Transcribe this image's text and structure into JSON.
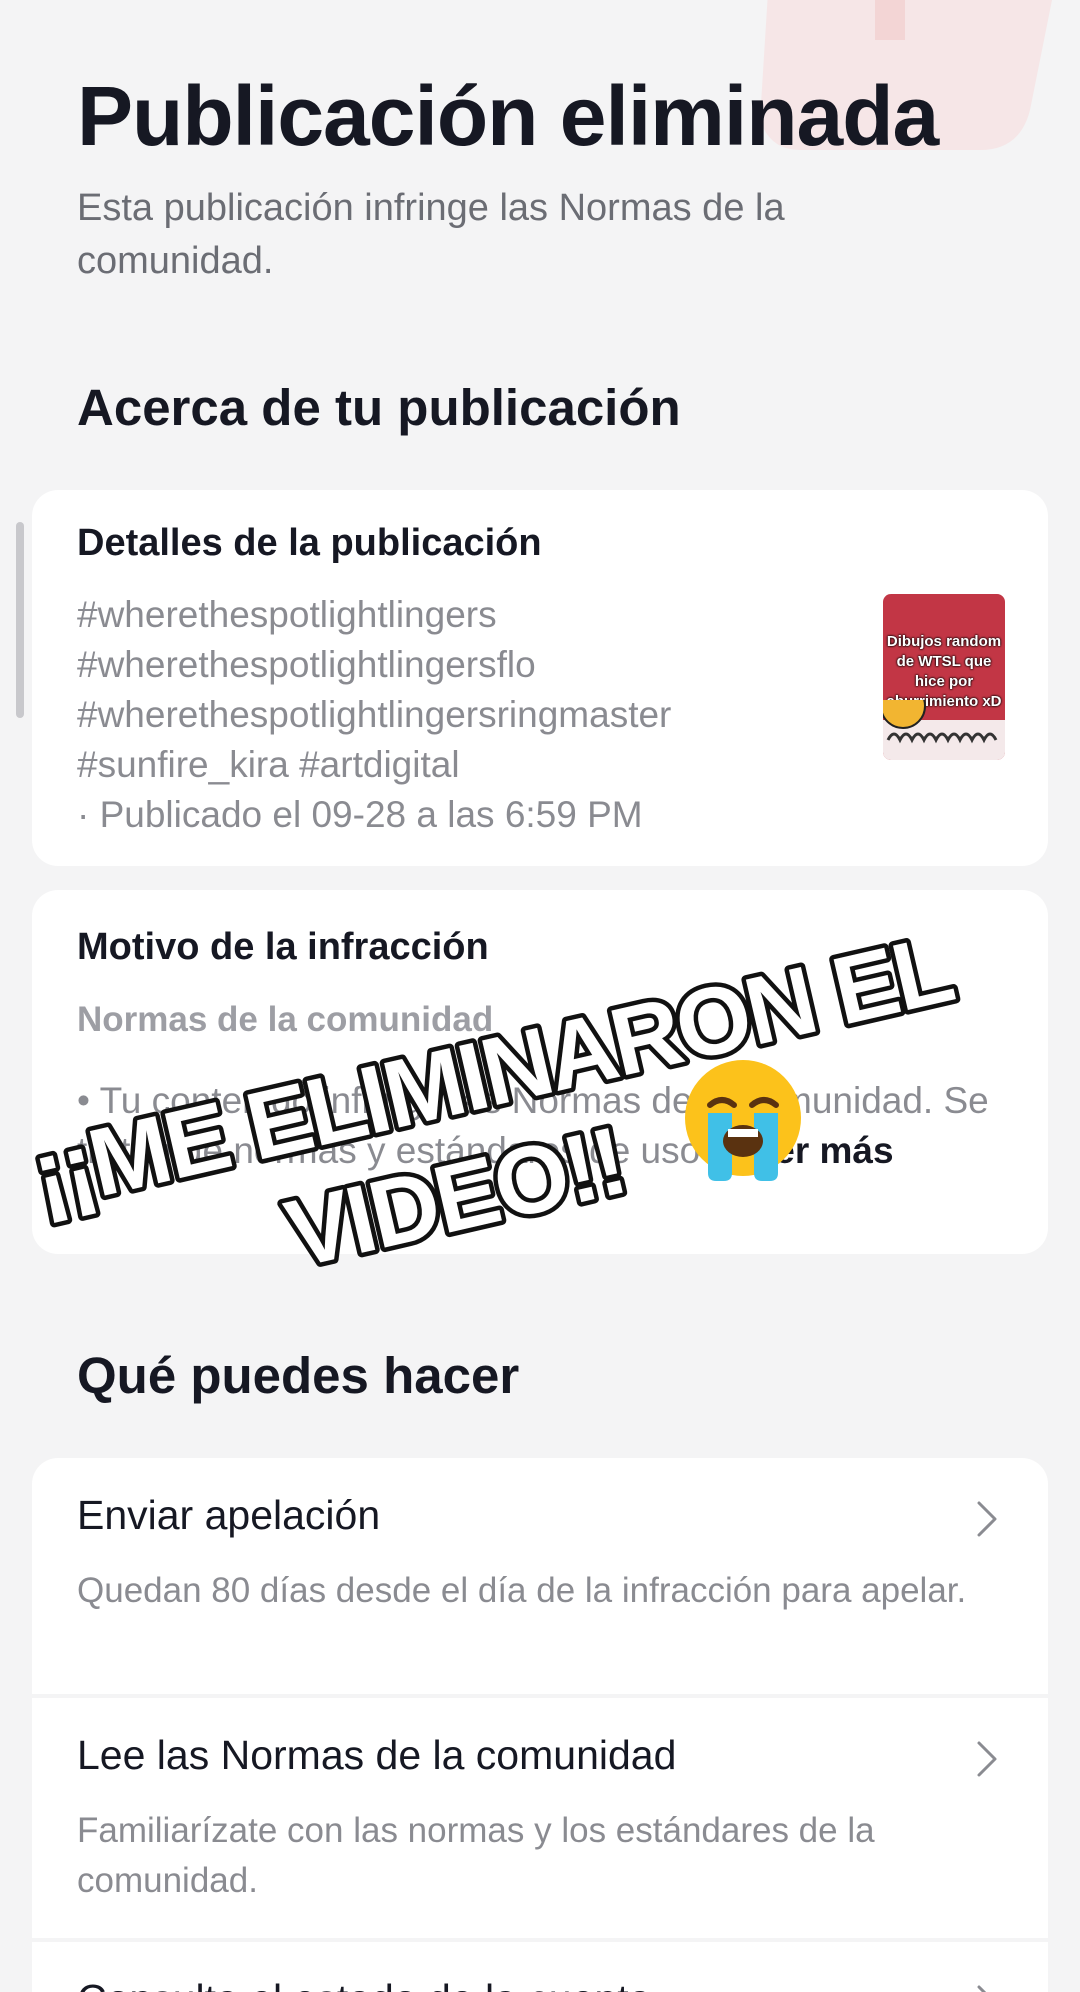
{
  "header": {
    "title": "Publicación eliminada",
    "subtitle": "Esta publicación infringe las Normas de la comunidad."
  },
  "about": {
    "section_title": "Acerca de tu publicación",
    "details": {
      "heading": "Detalles de la publicación",
      "tags_line1": "#wherethespotlightlingers",
      "tags_line2": "#wherethespotlightlingersflo",
      "tags_line3": "#wherethespotlightlingersringmaster",
      "tags_line4": "#sunfire_kira #artdigital",
      "published": "· Publicado el 09-28 a las 6:59 PM",
      "thumbnail_text": "Dibujos random de WTSL que hice por aburrimiento xD"
    },
    "reason": {
      "heading": "Motivo de la infracción",
      "subheading": "Normas de la comunidad",
      "body": "• Tu contenido infringe las Normas de la comunidad. Se tratan de normas y estándares de uso",
      "ellipsis": "...",
      "see_more": "Ver más"
    }
  },
  "actions": {
    "section_title": "Qué puedes hacer",
    "items": [
      {
        "label": "Enviar apelación",
        "description": "Quedan 80 días desde el día de la infracción para apelar."
      },
      {
        "label": "Lee las Normas de la comunidad",
        "description": "Familiarízate con las normas y los estándares de la comunidad."
      },
      {
        "label": "Consulta el estado de la cuenta"
      }
    ]
  },
  "overlay": {
    "line1": "¡¡ME ELIMINARON EL",
    "line2": "VIDEO!!",
    "emoji": "loudly-crying-face-emoji"
  },
  "colors": {
    "background": "#f4f4f5",
    "card": "#ffffff",
    "primary_text": "#161823",
    "secondary_text": "#8a8b91",
    "warning_bg": "#f7d4d4"
  }
}
